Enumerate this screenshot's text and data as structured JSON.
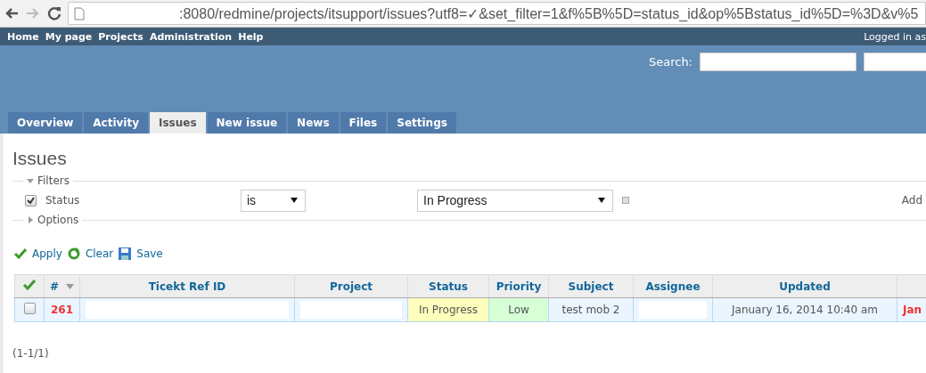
{
  "browser": {
    "url": ":8080/redmine/projects/itsupport/issues?utf8=✓&set_filter=1&f%5B%5D=status_id&op%5Bstatus_id%5D=%3D&v%5"
  },
  "top_menu": {
    "items": [
      "Home",
      "My page",
      "Projects",
      "Administration",
      "Help"
    ],
    "logged_in": "Logged in as"
  },
  "search": {
    "label": "Search:"
  },
  "tabs": [
    {
      "label": "Overview",
      "selected": false
    },
    {
      "label": "Activity",
      "selected": false
    },
    {
      "label": "Issues",
      "selected": true
    },
    {
      "label": "New issue",
      "selected": false
    },
    {
      "label": "News",
      "selected": false
    },
    {
      "label": "Files",
      "selected": false
    },
    {
      "label": "Settings",
      "selected": false
    }
  ],
  "title": "Issues",
  "filters": {
    "legend": "Filters",
    "expanded": true,
    "add_label": "Add",
    "rows": [
      {
        "checked": true,
        "field": "Status",
        "operator": "is",
        "value": "In Progress"
      }
    ]
  },
  "options": {
    "legend": "Options",
    "expanded": false
  },
  "actions": [
    {
      "kind": "apply",
      "label": "Apply"
    },
    {
      "kind": "clear",
      "label": "Clear"
    },
    {
      "kind": "save",
      "label": "Save"
    }
  ],
  "table": {
    "columns": [
      {
        "kind": "check"
      },
      {
        "kind": "sort",
        "label": "#"
      },
      {
        "kind": "text",
        "label": "Ticekt Ref ID"
      },
      {
        "kind": "text",
        "label": "Project"
      },
      {
        "kind": "text",
        "label": "Status"
      },
      {
        "kind": "text",
        "label": "Priority"
      },
      {
        "kind": "text",
        "label": "Subject"
      },
      {
        "kind": "text",
        "label": "Assignee"
      },
      {
        "kind": "text",
        "label": "Updated"
      },
      {
        "kind": "blank"
      }
    ],
    "rows": [
      {
        "selected": false,
        "cells": [
          {
            "kind": "checkbox",
            "checked": false
          },
          {
            "kind": "id",
            "text": "261"
          },
          {
            "kind": "redacted"
          },
          {
            "kind": "redacted"
          },
          {
            "kind": "status",
            "text": "In Progress"
          },
          {
            "kind": "priority",
            "text": "Low"
          },
          {
            "kind": "text",
            "text": "test mob 2"
          },
          {
            "kind": "redacted"
          },
          {
            "kind": "text",
            "text": "January 16, 2014 10:40 am"
          },
          {
            "kind": "due",
            "text": "Jan"
          }
        ]
      }
    ]
  },
  "pagination": "(1-1/1)"
}
